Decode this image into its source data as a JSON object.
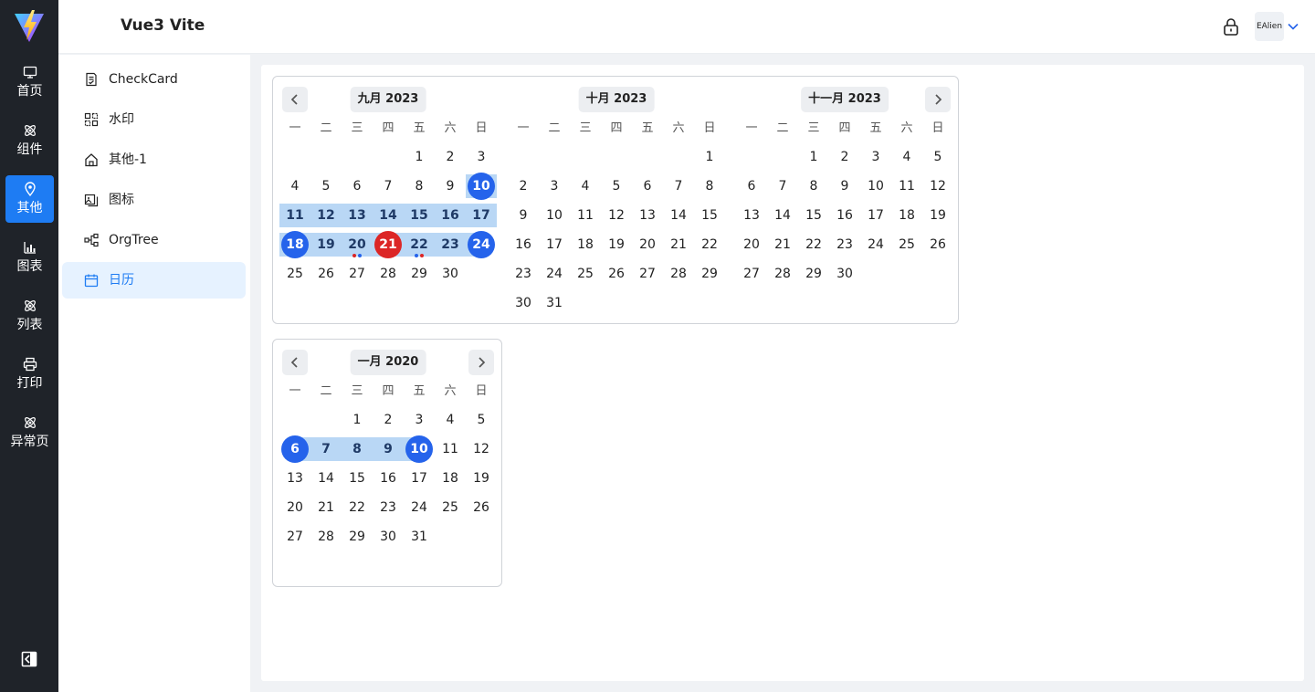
{
  "app": {
    "title": "Vue3 Vite"
  },
  "user": {
    "name": "EAlien"
  },
  "colors": {
    "accent": "#1e7cf3",
    "selected": "#2563eb",
    "today": "#dc2626",
    "range": "#b9d7f5",
    "dot_red": "#dc2626",
    "dot_blue": "#2563eb"
  },
  "rail": {
    "items": [
      {
        "label": "首页",
        "icon": "monitor-icon",
        "active": false
      },
      {
        "label": "组件",
        "icon": "atom-icon",
        "active": false
      },
      {
        "label": "其他",
        "icon": "map-pin-icon",
        "active": true
      },
      {
        "label": "图表",
        "icon": "bar-chart-icon",
        "active": false
      },
      {
        "label": "列表",
        "icon": "atom-icon",
        "active": false
      },
      {
        "label": "打印",
        "icon": "printer-icon",
        "active": false
      },
      {
        "label": "异常页",
        "icon": "atom-icon",
        "active": false
      }
    ]
  },
  "submenu": {
    "items": [
      {
        "label": "CheckCard",
        "icon": "checklist-icon",
        "active": false
      },
      {
        "label": "水印",
        "icon": "watermark-icon",
        "active": false
      },
      {
        "label": "其他-1",
        "icon": "home-icon",
        "active": false
      },
      {
        "label": "图标",
        "icon": "image-icon",
        "active": false
      },
      {
        "label": "OrgTree",
        "icon": "org-tree-icon",
        "active": false
      },
      {
        "label": "日历",
        "icon": "calendar-icon",
        "active": true
      }
    ]
  },
  "weekdays": [
    "一",
    "二",
    "三",
    "四",
    "五",
    "六",
    "日"
  ],
  "calendars": [
    {
      "months": [
        {
          "title": "九月 2023",
          "first_weekday": 4,
          "days_in_month": 30,
          "selected": [
            10,
            18,
            24
          ],
          "range_rows": [
            [
              10,
              10
            ],
            [
              11,
              17
            ],
            [
              18,
              24
            ]
          ],
          "today": 21,
          "dots": {
            "20": [
              "red",
              "blue"
            ],
            "22": [
              "blue",
              "red"
            ]
          }
        },
        {
          "title": "十月 2023",
          "first_weekday": 6,
          "days_in_month": 31,
          "selected": [],
          "range_rows": [],
          "today": null,
          "dots": {}
        },
        {
          "title": "十一月 2023",
          "first_weekday": 2,
          "days_in_month": 30,
          "selected": [],
          "range_rows": [],
          "today": null,
          "dots": {}
        }
      ]
    },
    {
      "months": [
        {
          "title": "一月 2020",
          "first_weekday": 2,
          "days_in_month": 31,
          "selected": [
            6,
            10
          ],
          "range_rows": [
            [
              6,
              10
            ]
          ],
          "today": null,
          "dots": {}
        }
      ]
    }
  ]
}
